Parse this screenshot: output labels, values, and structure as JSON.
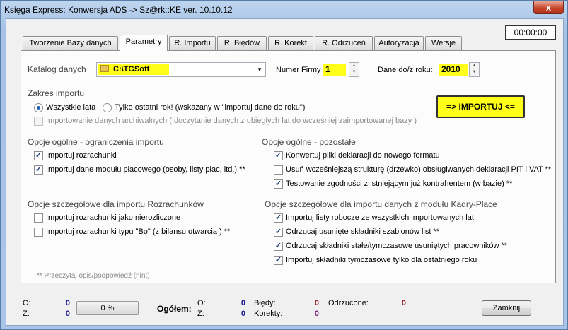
{
  "window": {
    "title": "Księga Express:   Konwersja  ADS  ->  Sz@rk::KE    ver. 10.10.12",
    "close_glyph": "x"
  },
  "timer": "00:00:00",
  "tabs": [
    {
      "label": "Tworzenie Bazy danych"
    },
    {
      "label": "Parametry",
      "active": true
    },
    {
      "label": "R. Importu"
    },
    {
      "label": "R. Błędów"
    },
    {
      "label": "R. Korekt"
    },
    {
      "label": "R. Odrzuceń"
    },
    {
      "label": "Autoryzacja"
    },
    {
      "label": "Wersje"
    }
  ],
  "params": {
    "catalog_label": "Katalog danych",
    "catalog_value": "C:\\TGSoft",
    "company_label": "Numer Firmy",
    "company_value": "1",
    "year_label": "Dane do/z roku:",
    "year_value": "2010"
  },
  "import_range": {
    "header": "Zakres importu",
    "opt_all": "Wszystkie lata",
    "opt_last": "Tylko ostatni rok!  (wskazany w \"importuj dane do roku\")",
    "archive": "Importowanie danych archiwalnych ( doczytanie danych z ubiegłych lat do wcześniej zaimportowanej bazy )"
  },
  "import_button": "=>  IMPORTUJ  <=",
  "general_limits": {
    "header": "Opcje ogólne  - ograniczenia importu",
    "items": [
      {
        "label": "Importuj rozrachunki",
        "checked": true
      },
      {
        "label": "Importuj dane modułu płacowego (osoby, listy płac, itd.) **",
        "checked": true
      }
    ]
  },
  "general_other": {
    "header": "Opcje ogólne  - pozostałe",
    "items": [
      {
        "label": "Konwertuj pliki deklaracji do nowego formatu",
        "checked": true
      },
      {
        "label": "Usuń wcześniejszą strukturę (drzewko) obsługiwanych deklaracji PIT i VAT **",
        "checked": false
      },
      {
        "label": "Testowanie zgodności z istniejącym już kontrahentem (w bazie) **",
        "checked": true
      }
    ]
  },
  "settlements": {
    "header": "Opcje szczegółowe dla importu Rozrachunków",
    "items": [
      {
        "label": "Importuj rozrachunki jako nierozliczone",
        "checked": false
      },
      {
        "label": "Importuj rozrachunki typu \"Bo\"  (z bilansu otwarcia ) **",
        "checked": false
      }
    ]
  },
  "hr": {
    "header": "Opcje szczegółowe dla importu danych z modułu Kadry-Płace",
    "items": [
      {
        "label": "Importuj listy robocze ze wszystkich importowanych lat",
        "checked": true
      },
      {
        "label": "Odrzucaj usunięte składniki szablonów list  **",
        "checked": true
      },
      {
        "label": "Odrzucaj składniki stałe/tymczasowe usuniętych pracowników **",
        "checked": true
      },
      {
        "label": "Importuj składniki tymczasowe tylko dla ostatniego roku",
        "checked": true
      }
    ]
  },
  "hint": "**   Przeczytaj opis/podpowiedź (hint)",
  "footer": {
    "o_label": "O:",
    "o_value": "0",
    "z_label": "Z:",
    "z_value": "0",
    "progress": "0 %",
    "total_label": "Ogółem:",
    "total_o_label": "O:",
    "total_o_value": "0",
    "total_z_label": "Z:",
    "total_z_value": "0",
    "errors_label": "Błędy:",
    "errors_value": "0",
    "corrections_label": "Korekty:",
    "corrections_value": "0",
    "rejected_label": "Odrzucone:",
    "rejected_value": "0",
    "close_button": "Zamknij"
  },
  "colors": {
    "blue_value": "#1c1c8c",
    "red_value": "#8c1c1c",
    "purple_value": "#7a1c7a",
    "highlight": "#ffff1a"
  }
}
